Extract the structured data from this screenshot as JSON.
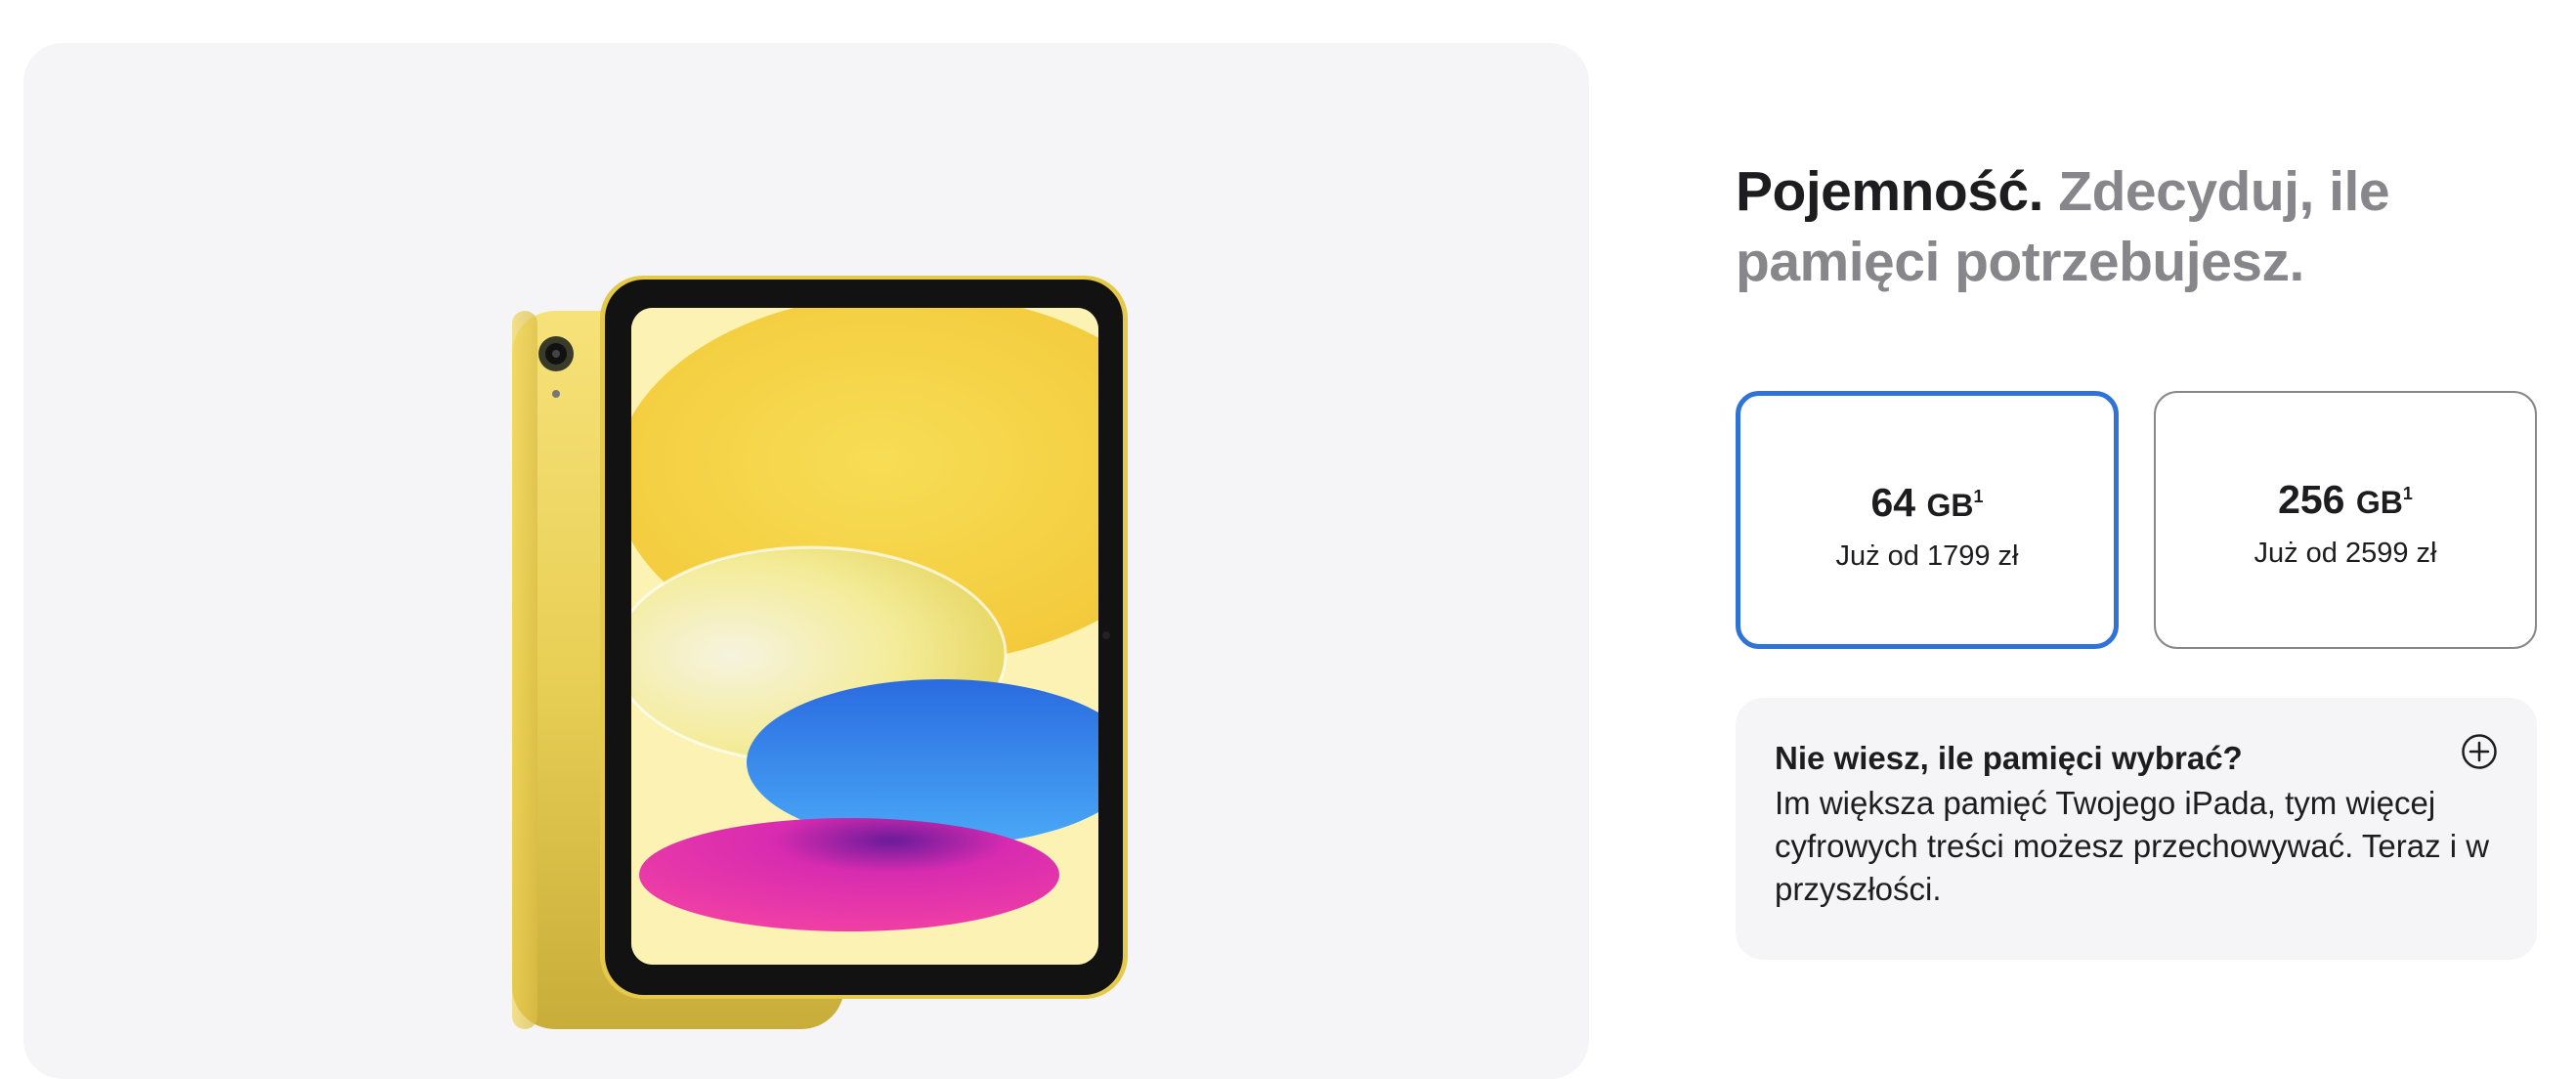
{
  "capacity": {
    "heading_strong": "Pojemność.",
    "heading_muted": "Zdecyduj, ile pamięci potrzebujesz.",
    "options": [
      {
        "size": "64",
        "unit": "GB",
        "footnote": "1",
        "price": "Już od 1799 zł",
        "selected": true
      },
      {
        "size": "256",
        "unit": "GB",
        "footnote": "1",
        "price": "Już od 2599 zł",
        "selected": false
      }
    ],
    "help": {
      "title": "Nie wiesz, ile pamięci wybrać?",
      "body": "Im większa pamięć Twojego iPada, tym więcej cyfrowych treści możesz przechowywać. Teraz i w przyszłości.",
      "icon": "plus-circle-icon"
    }
  },
  "product_image": {
    "device_color": "#f4da52",
    "accent": "#2f73d6"
  }
}
